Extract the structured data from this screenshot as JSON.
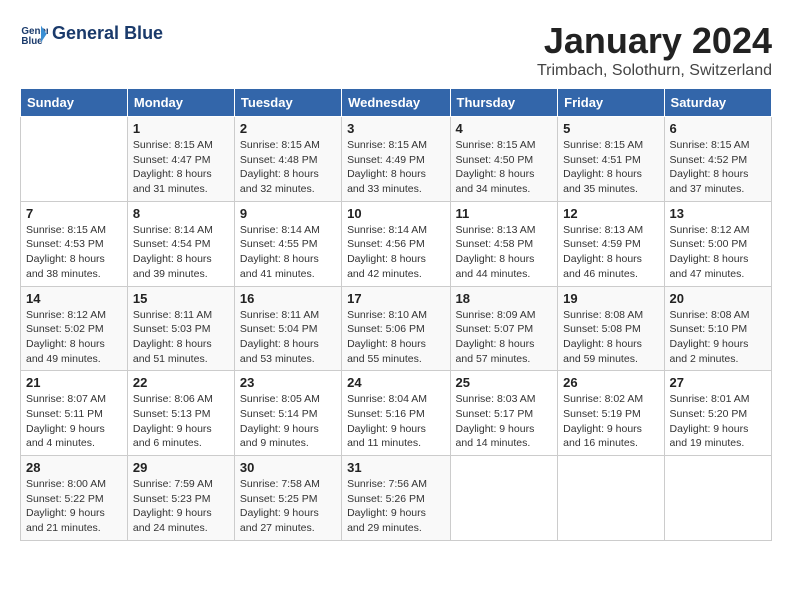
{
  "logo": {
    "line1": "General",
    "line2": "Blue"
  },
  "title": "January 2024",
  "location": "Trimbach, Solothurn, Switzerland",
  "days_of_week": [
    "Sunday",
    "Monday",
    "Tuesday",
    "Wednesday",
    "Thursday",
    "Friday",
    "Saturday"
  ],
  "weeks": [
    [
      {
        "day": "",
        "detail": ""
      },
      {
        "day": "1",
        "detail": "Sunrise: 8:15 AM\nSunset: 4:47 PM\nDaylight: 8 hours\nand 31 minutes."
      },
      {
        "day": "2",
        "detail": "Sunrise: 8:15 AM\nSunset: 4:48 PM\nDaylight: 8 hours\nand 32 minutes."
      },
      {
        "day": "3",
        "detail": "Sunrise: 8:15 AM\nSunset: 4:49 PM\nDaylight: 8 hours\nand 33 minutes."
      },
      {
        "day": "4",
        "detail": "Sunrise: 8:15 AM\nSunset: 4:50 PM\nDaylight: 8 hours\nand 34 minutes."
      },
      {
        "day": "5",
        "detail": "Sunrise: 8:15 AM\nSunset: 4:51 PM\nDaylight: 8 hours\nand 35 minutes."
      },
      {
        "day": "6",
        "detail": "Sunrise: 8:15 AM\nSunset: 4:52 PM\nDaylight: 8 hours\nand 37 minutes."
      }
    ],
    [
      {
        "day": "7",
        "detail": "Sunrise: 8:15 AM\nSunset: 4:53 PM\nDaylight: 8 hours\nand 38 minutes."
      },
      {
        "day": "8",
        "detail": "Sunrise: 8:14 AM\nSunset: 4:54 PM\nDaylight: 8 hours\nand 39 minutes."
      },
      {
        "day": "9",
        "detail": "Sunrise: 8:14 AM\nSunset: 4:55 PM\nDaylight: 8 hours\nand 41 minutes."
      },
      {
        "day": "10",
        "detail": "Sunrise: 8:14 AM\nSunset: 4:56 PM\nDaylight: 8 hours\nand 42 minutes."
      },
      {
        "day": "11",
        "detail": "Sunrise: 8:13 AM\nSunset: 4:58 PM\nDaylight: 8 hours\nand 44 minutes."
      },
      {
        "day": "12",
        "detail": "Sunrise: 8:13 AM\nSunset: 4:59 PM\nDaylight: 8 hours\nand 46 minutes."
      },
      {
        "day": "13",
        "detail": "Sunrise: 8:12 AM\nSunset: 5:00 PM\nDaylight: 8 hours\nand 47 minutes."
      }
    ],
    [
      {
        "day": "14",
        "detail": "Sunrise: 8:12 AM\nSunset: 5:02 PM\nDaylight: 8 hours\nand 49 minutes."
      },
      {
        "day": "15",
        "detail": "Sunrise: 8:11 AM\nSunset: 5:03 PM\nDaylight: 8 hours\nand 51 minutes."
      },
      {
        "day": "16",
        "detail": "Sunrise: 8:11 AM\nSunset: 5:04 PM\nDaylight: 8 hours\nand 53 minutes."
      },
      {
        "day": "17",
        "detail": "Sunrise: 8:10 AM\nSunset: 5:06 PM\nDaylight: 8 hours\nand 55 minutes."
      },
      {
        "day": "18",
        "detail": "Sunrise: 8:09 AM\nSunset: 5:07 PM\nDaylight: 8 hours\nand 57 minutes."
      },
      {
        "day": "19",
        "detail": "Sunrise: 8:08 AM\nSunset: 5:08 PM\nDaylight: 8 hours\nand 59 minutes."
      },
      {
        "day": "20",
        "detail": "Sunrise: 8:08 AM\nSunset: 5:10 PM\nDaylight: 9 hours\nand 2 minutes."
      }
    ],
    [
      {
        "day": "21",
        "detail": "Sunrise: 8:07 AM\nSunset: 5:11 PM\nDaylight: 9 hours\nand 4 minutes."
      },
      {
        "day": "22",
        "detail": "Sunrise: 8:06 AM\nSunset: 5:13 PM\nDaylight: 9 hours\nand 6 minutes."
      },
      {
        "day": "23",
        "detail": "Sunrise: 8:05 AM\nSunset: 5:14 PM\nDaylight: 9 hours\nand 9 minutes."
      },
      {
        "day": "24",
        "detail": "Sunrise: 8:04 AM\nSunset: 5:16 PM\nDaylight: 9 hours\nand 11 minutes."
      },
      {
        "day": "25",
        "detail": "Sunrise: 8:03 AM\nSunset: 5:17 PM\nDaylight: 9 hours\nand 14 minutes."
      },
      {
        "day": "26",
        "detail": "Sunrise: 8:02 AM\nSunset: 5:19 PM\nDaylight: 9 hours\nand 16 minutes."
      },
      {
        "day": "27",
        "detail": "Sunrise: 8:01 AM\nSunset: 5:20 PM\nDaylight: 9 hours\nand 19 minutes."
      }
    ],
    [
      {
        "day": "28",
        "detail": "Sunrise: 8:00 AM\nSunset: 5:22 PM\nDaylight: 9 hours\nand 21 minutes."
      },
      {
        "day": "29",
        "detail": "Sunrise: 7:59 AM\nSunset: 5:23 PM\nDaylight: 9 hours\nand 24 minutes."
      },
      {
        "day": "30",
        "detail": "Sunrise: 7:58 AM\nSunset: 5:25 PM\nDaylight: 9 hours\nand 27 minutes."
      },
      {
        "day": "31",
        "detail": "Sunrise: 7:56 AM\nSunset: 5:26 PM\nDaylight: 9 hours\nand 29 minutes."
      },
      {
        "day": "",
        "detail": ""
      },
      {
        "day": "",
        "detail": ""
      },
      {
        "day": "",
        "detail": ""
      }
    ]
  ]
}
